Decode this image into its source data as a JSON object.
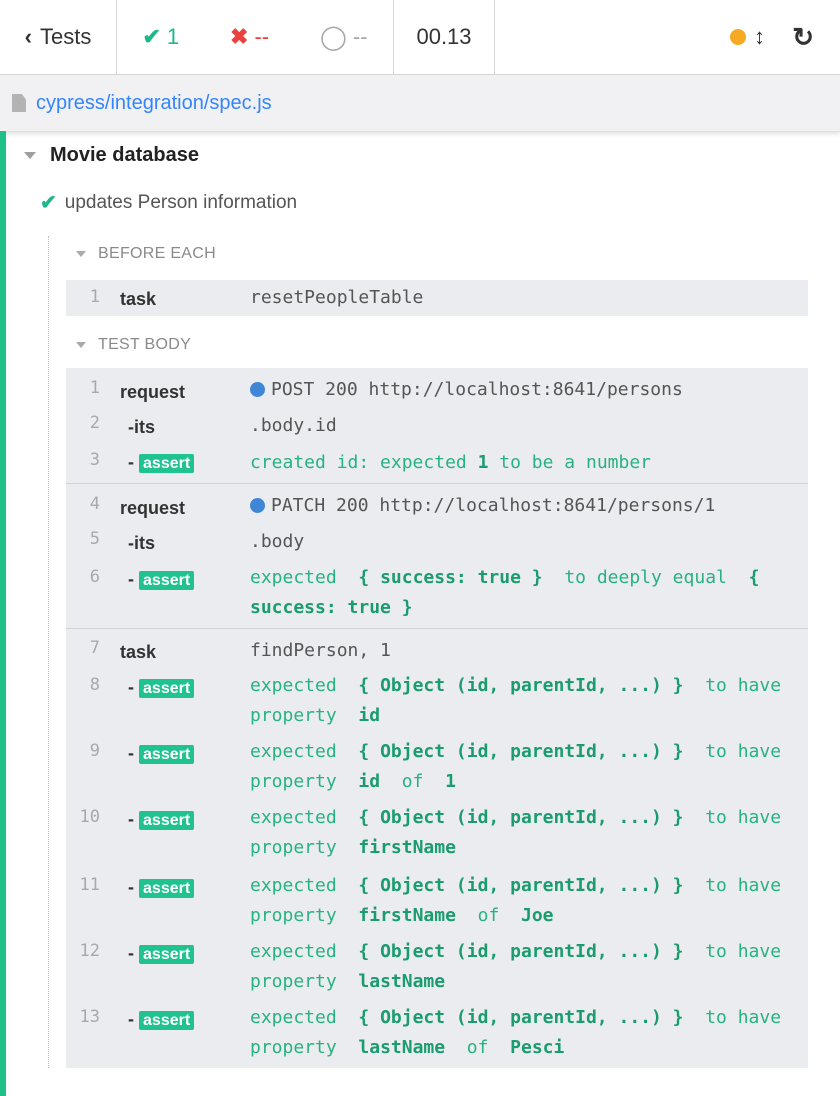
{
  "header": {
    "tests_label": "Tests",
    "passed_count": "1",
    "failed_count": "--",
    "pending_count": "--",
    "duration": "00.13"
  },
  "file": {
    "path": "cypress/integration/spec.js"
  },
  "suite": {
    "title": "Movie database"
  },
  "test": {
    "title": "updates Person information"
  },
  "sections": {
    "before_each": "BEFORE EACH",
    "test_body": "TEST BODY"
  },
  "before_each_commands": [
    {
      "num": "1",
      "name": "task",
      "message": "resetPeopleTable"
    }
  ],
  "group1": {
    "r1": {
      "num": "1",
      "name": "request",
      "message": "POST 200 http://localhost:8641/persons"
    },
    "r2": {
      "num": "2",
      "name": "-its",
      "message": ".body.id"
    },
    "r3": {
      "num": "3",
      "dash": "-",
      "badge": "assert",
      "m1": "created id: expected",
      "m2": "1",
      "m3": "to be a number"
    }
  },
  "group2": {
    "r4": {
      "num": "4",
      "name": "request",
      "message": "PATCH 200 http://localhost:8641/persons/1"
    },
    "r5": {
      "num": "5",
      "name": "-its",
      "message": ".body"
    },
    "r6": {
      "num": "6",
      "dash": "-",
      "badge": "assert",
      "m1": "expected",
      "m2": "{ success: true }",
      "m3": "to deeply equal",
      "m4": "{ success: true }"
    }
  },
  "group3": {
    "r7": {
      "num": "7",
      "name": "task",
      "message": "findPerson, 1"
    },
    "r8": {
      "num": "8",
      "dash": "-",
      "badge": "assert",
      "m1": "expected",
      "m2": "{ Object (id, parentId, ...) }",
      "m3": "to have property",
      "m4": "id"
    },
    "r9": {
      "num": "9",
      "dash": "-",
      "badge": "assert",
      "m1": "expected",
      "m2": "{ Object (id, parentId, ...) }",
      "m3": "to have property",
      "m4": "id",
      "m5": "of",
      "m6": "1"
    },
    "r10": {
      "num": "10",
      "dash": "-",
      "badge": "assert",
      "m1": "expected",
      "m2": "{ Object (id, parentId, ...) }",
      "m3": "to have property",
      "m4": "firstName"
    },
    "r11": {
      "num": "11",
      "dash": "-",
      "badge": "assert",
      "m1": "expected",
      "m2": "{ Object (id, parentId, ...) }",
      "m3": "to have property",
      "m4": "firstName",
      "m5": "of",
      "m6": "Joe"
    },
    "r12": {
      "num": "12",
      "dash": "-",
      "badge": "assert",
      "m1": "expected",
      "m2": "{ Object (id, parentId, ...) }",
      "m3": "to have property",
      "m4": "lastName"
    },
    "r13": {
      "num": "13",
      "dash": "-",
      "badge": "assert",
      "m1": "expected",
      "m2": "{ Object (id, parentId, ...) }",
      "m3": "to have property",
      "m4": "lastName",
      "m5": "of",
      "m6": "Pesci"
    }
  },
  "colors": {
    "pass": "#1fb88a",
    "fail": "#e8413f",
    "link": "#3385ff",
    "rail": "#1fbf89",
    "badge": "#20c28f"
  }
}
